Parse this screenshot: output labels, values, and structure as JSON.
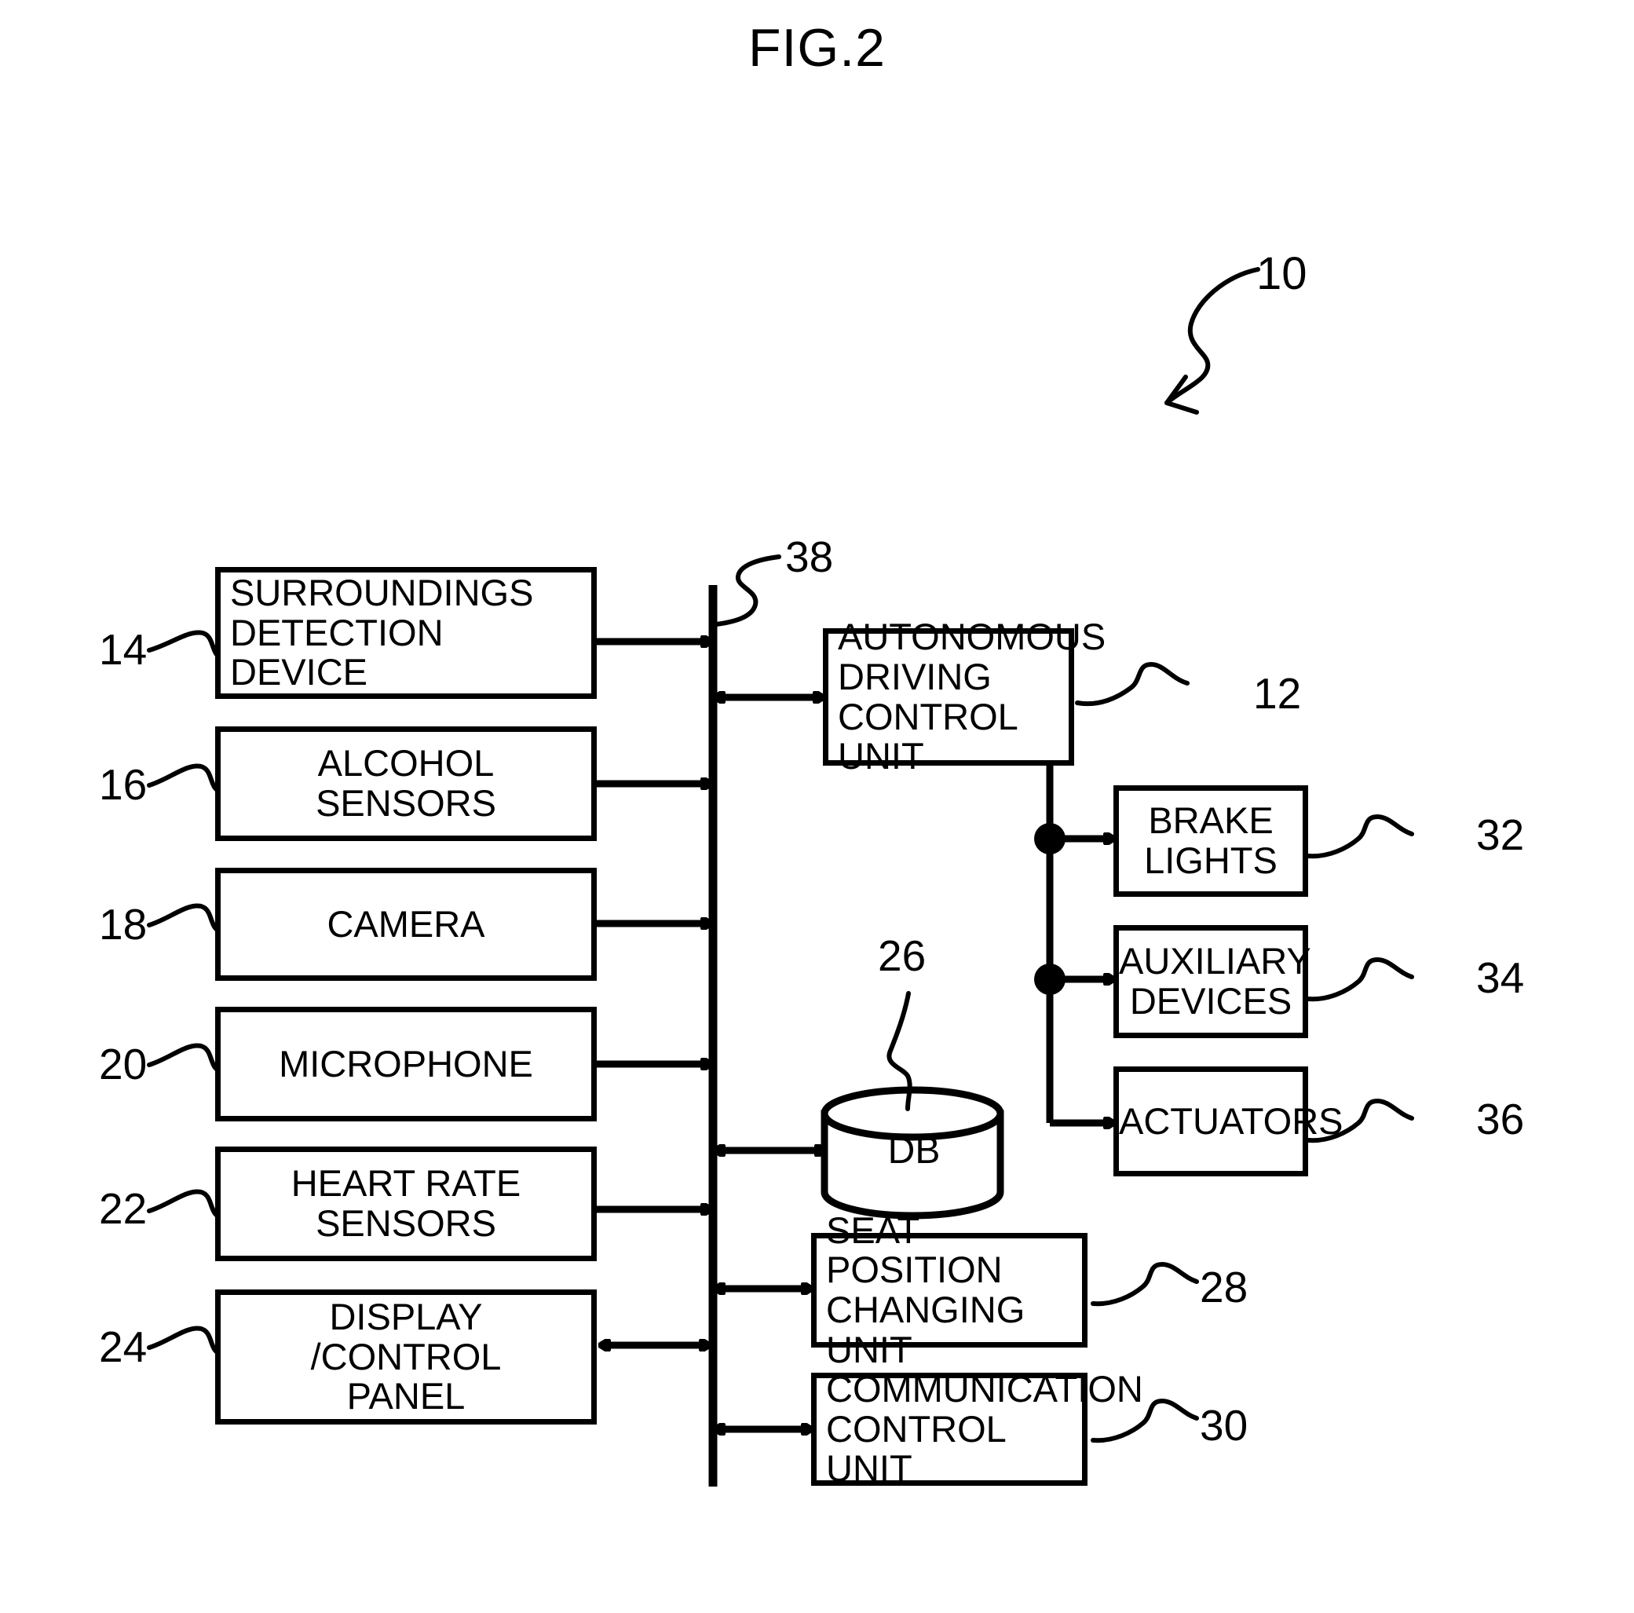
{
  "figure": {
    "title": "FIG.2",
    "system_ref": "10"
  },
  "refs": {
    "surroundings_detection_device": "14",
    "alcohol_sensors": "16",
    "camera": "18",
    "microphone": "20",
    "heart_rate_sensors": "22",
    "display_control_panel": "24",
    "autonomous_driving_control_unit": "12",
    "database": "26",
    "seat_position_changing_unit": "28",
    "communication_control_unit": "30",
    "brake_lights": "32",
    "auxiliary_devices": "34",
    "actuators": "36",
    "bus": "38"
  },
  "left_column": [
    {
      "id": "surroundings-detection-device",
      "lines": [
        "SURROUNDINGS",
        "DETECTION",
        "DEVICE"
      ],
      "ref": "14",
      "align": "left"
    },
    {
      "id": "alcohol-sensors",
      "lines": [
        "ALCOHOL",
        "SENSORS"
      ],
      "ref": "16",
      "align": "center"
    },
    {
      "id": "camera",
      "lines": [
        "CAMERA"
      ],
      "ref": "18",
      "align": "center"
    },
    {
      "id": "microphone",
      "lines": [
        "MICROPHONE"
      ],
      "ref": "20",
      "align": "center"
    },
    {
      "id": "heart-rate-sensors",
      "lines": [
        "HEART RATE",
        "SENSORS"
      ],
      "ref": "22",
      "align": "center"
    },
    {
      "id": "display-control-panel",
      "lines": [
        "DISPLAY",
        "/CONTROL",
        "PANEL"
      ],
      "ref": "24",
      "align": "center"
    }
  ],
  "right_column": [
    {
      "id": "autonomous-driving-control-unit",
      "lines": [
        "AUTONOMOUS",
        "DRIVING",
        "CONTROL UNIT"
      ],
      "ref": "12",
      "align": "left"
    },
    {
      "id": "seat-position-changing-unit",
      "lines": [
        "SEAT POSITION",
        "CHANGING UNIT"
      ],
      "ref": "28",
      "align": "left"
    },
    {
      "id": "communication-control-unit",
      "lines": [
        "COMMUNICATION",
        "CONTROL UNIT"
      ],
      "ref": "30",
      "align": "left"
    }
  ],
  "actuator_column": [
    {
      "id": "brake-lights",
      "lines": [
        "BRAKE",
        "LIGHTS"
      ],
      "ref": "32",
      "align": "center"
    },
    {
      "id": "auxiliary-devices",
      "lines": [
        "AUXILIARY",
        "DEVICES"
      ],
      "ref": "34",
      "align": "center"
    },
    {
      "id": "actuators",
      "lines": [
        "ACTUATORS"
      ],
      "ref": "36",
      "align": "center"
    }
  ],
  "database": {
    "id": "database-cylinder",
    "label": "DB",
    "ref": "26"
  },
  "box_text": {
    "surroundings_l1": "SURROUNDINGS",
    "surroundings_l2": "DETECTION",
    "surroundings_l3": "DEVICE",
    "alcohol_l1": "ALCOHOL",
    "alcohol_l2": "SENSORS",
    "camera_l1": "CAMERA",
    "microphone_l1": "MICROPHONE",
    "heart_l1": "HEART RATE",
    "heart_l2": "SENSORS",
    "display_l1": "DISPLAY",
    "display_l2": "/CONTROL",
    "display_l3": "PANEL",
    "adcu_l1": "AUTONOMOUS",
    "adcu_l2": "DRIVING",
    "adcu_l3": "CONTROL UNIT",
    "brake_l1": "BRAKE",
    "brake_l2": "LIGHTS",
    "aux_l1": "AUXILIARY",
    "aux_l2": "DEVICES",
    "act_l1": "ACTUATORS",
    "seat_l1": "SEAT POSITION",
    "seat_l2": "CHANGING UNIT",
    "comm_l1": "COMMUNICATION",
    "comm_l2": "CONTROL UNIT",
    "db_label": "DB"
  },
  "colors": {
    "ink": "#000000",
    "paper": "#ffffff"
  }
}
